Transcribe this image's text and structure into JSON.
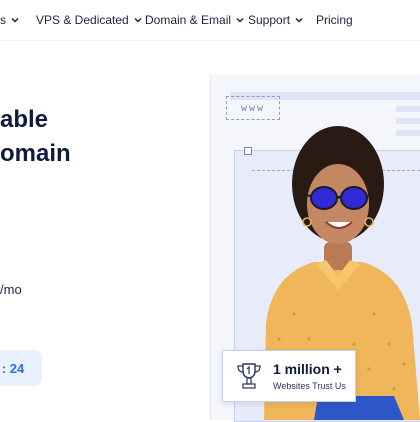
{
  "nav": {
    "items": [
      {
        "label": "s",
        "has_dropdown": true
      },
      {
        "label": "VPS & Dedicated",
        "has_dropdown": true
      },
      {
        "label": "Domain & Email",
        "has_dropdown": true
      },
      {
        "label": "Support",
        "has_dropdown": true
      },
      {
        "label": "Pricing",
        "has_dropdown": false
      }
    ]
  },
  "hero": {
    "line1": "able",
    "line2": "omain",
    "price_unit": "/mo",
    "timer_value": ": 24"
  },
  "visual": {
    "www_label": "www",
    "trust_headline": "1 million +",
    "trust_sub": "Websites Trust Us"
  },
  "colors": {
    "accent": "#2f6df6",
    "heading": "#0f1b3d",
    "panel": "#e7ebfa"
  }
}
